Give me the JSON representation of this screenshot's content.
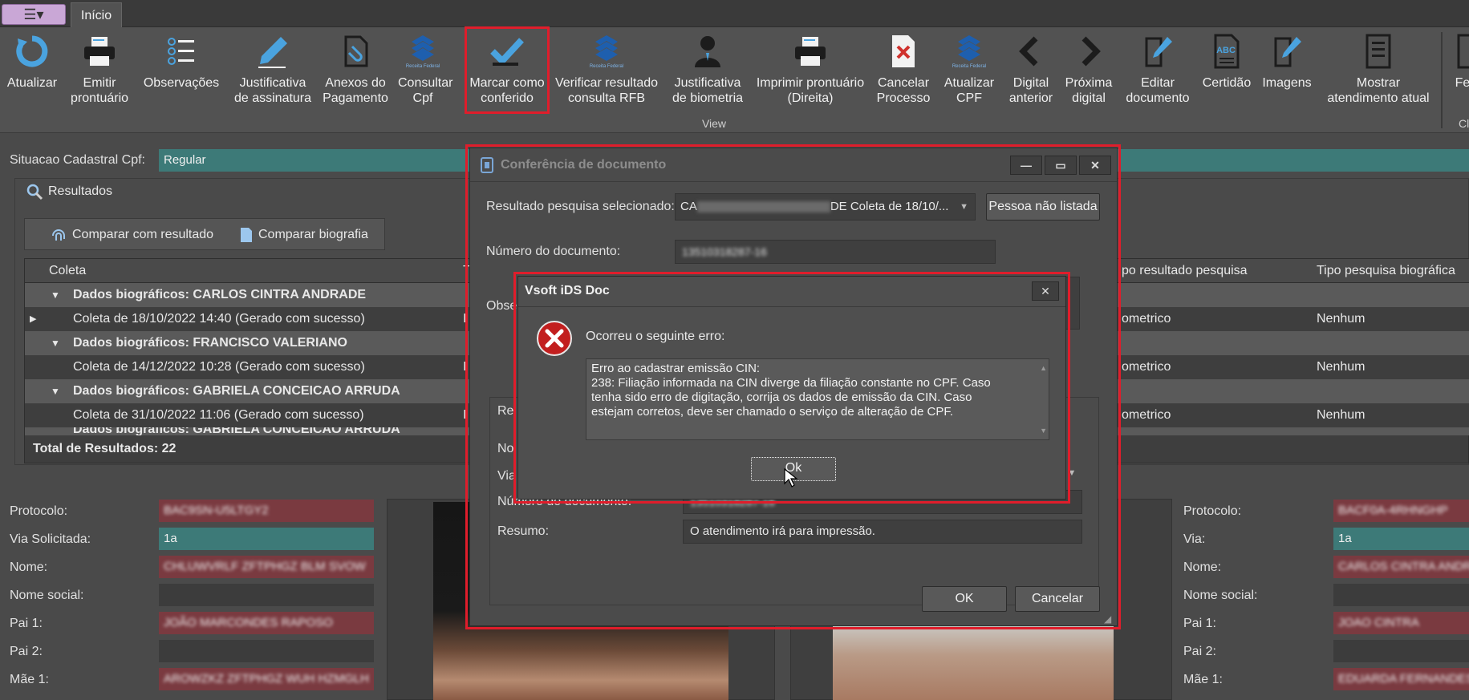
{
  "app": {
    "menu_button": "☰▾",
    "tab_inicio": "Início"
  },
  "ribbon": {
    "buttons": [
      {
        "label": "Atualizar"
      },
      {
        "label": "Emitir\nprontuário"
      },
      {
        "label": "Observações"
      },
      {
        "label": "Justificativa\nde assinatura"
      },
      {
        "label": "Anexos do\nPagamento"
      },
      {
        "label": "Consultar\nCpf"
      },
      {
        "label": "Marcar como\nconferido"
      },
      {
        "label": "Verificar resultado\nconsulta RFB"
      },
      {
        "label": "Justificativa\nde biometria"
      },
      {
        "label": "Imprimir prontuário\n(Direita)"
      },
      {
        "label": "Cancelar\nProcesso"
      },
      {
        "label": "Atualizar\nCPF"
      },
      {
        "label": "Digital\nanterior"
      },
      {
        "label": "Próxima\ndigital"
      },
      {
        "label": "Editar\ndocumento"
      },
      {
        "label": "Certidão"
      },
      {
        "label": "Imagens"
      },
      {
        "label": "Mostrar\natendimento atual"
      },
      {
        "label": "Fe"
      }
    ],
    "group_label": "View",
    "group_label_right": "Cl",
    "receita_text": "Receita Federal"
  },
  "situacao": {
    "label": "Situacao Cadastral Cpf:",
    "value": "Regular"
  },
  "resultados": {
    "title": "Resultados",
    "compare_result": "Comparar com resultado",
    "compare_bio": "Comparar biografia",
    "columns": {
      "coleta": "Coleta",
      "c2": "T",
      "tipo_resultado": "po resultado pesquisa",
      "tipo_bio": "Tipo pesquisa biográfica"
    },
    "groups": [
      {
        "header": "Dados biográficos: CARLOS CINTRA ANDRADE",
        "item": "Coleta de 18/10/2022 14:40 (Gerado com sucesso)",
        "c2": "I",
        "tipo": "ometrico",
        "bio": "Nenhum"
      },
      {
        "header": "Dados biográficos: FRANCISCO VALERIANO",
        "item": "Coleta de 14/12/2022 10:28 (Gerado com sucesso)",
        "c2": "I",
        "tipo": "ometrico",
        "bio": "Nenhum"
      },
      {
        "header": "Dados biográficos: GABRIELA CONCEICAO ARRUDA",
        "item": "Coleta de 31/10/2022 11:06 (Gerado com sucesso)",
        "c2": "I",
        "tipo": "ometrico",
        "bio": "Nenhum"
      }
    ],
    "partial_row": "Dados biográficos: GABRIELA CONCEICAO ARRUDA",
    "total": "Total de Resultados: 22"
  },
  "left_form": {
    "protocolo_label": "Protocolo:",
    "protocolo": "BAC9SN-U5LTGY2",
    "via_label": "Via Solicitada:",
    "via": "1a",
    "nome_label": "Nome:",
    "nome": "CHLUWVRLF ZFTPHGZ BLM SVOW",
    "nome_social_label": "Nome social:",
    "nome_social": "",
    "pai1_label": "Pai 1:",
    "pai1": "JOÃO MARCONDES RAPOSO",
    "pai2_label": "Pai 2:",
    "pai2": "",
    "mae1_label": "Mãe 1:",
    "mae1": "AROWZKZ ZFTPHGZ WUH HZMGLH"
  },
  "right_form": {
    "protocolo_label": "Protocolo:",
    "protocolo": "BACF0A-4RHNGHP",
    "via_label": "Via:",
    "via": "1a",
    "nome_label": "Nome:",
    "nome": "CARLOS CINTRA ANDRADE",
    "nome_social_label": "Nome social:",
    "nome_social": "",
    "pai1_label": "Pai 1:",
    "pai1": "JOAO CINTRA",
    "pai2_label": "Pai 2:",
    "pai2": "",
    "mae1_label": "Mãe 1:",
    "mae1": "EDUARDA FERNANDES"
  },
  "conferencia": {
    "title": "Conferência de documento",
    "resultado_label": "Resultado pesquisa selecionado:",
    "resultado_value": "CARLOS CINTRA ANDRADE Coleta de 18/10/...",
    "resultado_prefix": "CA",
    "resultado_suffix": "DE Coleta de 18/10/...",
    "pessoa_btn": "Pessoa não listada",
    "numero_label": "Número do documento:",
    "numero_value": "13510318287-16",
    "obs_label": "Obse",
    "re_label": "Re",
    "no_label": "No",
    "via_label": "Via",
    "numero2_label": "Número do documento:",
    "numero2_value": "13510318287-16",
    "resumo_label": "Resumo:",
    "resumo_value": "O atendimento irá para impressão.",
    "ok": "OK",
    "cancel": "Cancelar"
  },
  "error": {
    "title": "Vsoft iDS Doc",
    "heading": "Ocorreu o seguinte erro:",
    "message_lines": [
      "Erro ao cadastrar emissão CIN:",
      "238: Filiação informada na CIN diverge da filiação constante no CPF. Caso",
      "tenha sido erro de digitação, corrija os dados de emissão da CIN. Caso",
      "estejam corretos, deve ser chamado o serviço de alteração de CPF."
    ],
    "ok": "Ok"
  },
  "colors": {
    "highlight_red": "#e01d2b",
    "teal": "#3d7a78",
    "maroon": "#7a3a40"
  }
}
